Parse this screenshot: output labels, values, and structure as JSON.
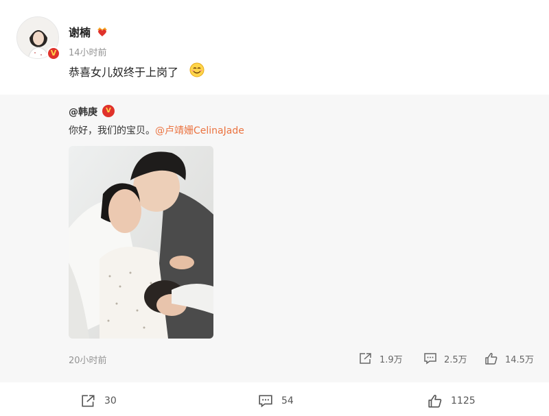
{
  "post": {
    "username": "谢楠",
    "time": "14小时前",
    "content": "恭喜女儿奴终于上岗了",
    "emoji_icon": "smile-emoji-icon",
    "vip_icon": "vip-crown-heart-icon"
  },
  "repost": {
    "mention_prefix": "@",
    "username": "韩庚",
    "text": "你好，我们的宝贝。",
    "mention": "@卢靖姗CelinaJade",
    "time": "20小时前",
    "share_count": "1.9万",
    "comment_count": "2.5万",
    "like_count": "14.5万"
  },
  "actions": {
    "share_count": "30",
    "comment_count": "54",
    "like_count": "1125"
  },
  "colors": {
    "verified": "#e0322b",
    "mention": "#eb7340",
    "repost_bg": "#f7f7f7"
  }
}
